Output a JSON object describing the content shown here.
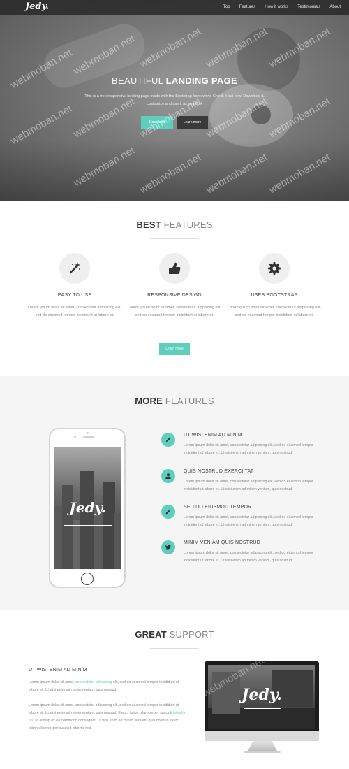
{
  "navbar": {
    "logo": "Jedy.",
    "items": [
      "Top",
      "Features",
      "How it works",
      "Testimonials",
      "About"
    ]
  },
  "hero": {
    "title_light": "BEAUTIFUL",
    "title_bold": "LANDING PAGE",
    "text": "This is a free responsive landing page made with the Bootstrap framework. Check it out now. Download it, customize and use it as you like!",
    "download_label": "Download",
    "learn_more_label": "Learn more"
  },
  "best_features": {
    "title_bold": "BEST",
    "title_light": "FEATURES",
    "items": [
      {
        "icon": "magic-wand-icon",
        "title": "EASY TO USE",
        "text": "Lorem ipsum dolor sit amet, consectetur adipiscing elit, sed do eiusmod tempor incididunt ut labore et."
      },
      {
        "icon": "thumbs-up-icon",
        "title": "RESPONSIVE DESIGN",
        "text": "Lorem ipsum dolor sit amet, consectetur adipiscing elit, sed do eiusmod tempor incididunt ut labore et."
      },
      {
        "icon": "gear-icon",
        "title": "USES BOOTSTRAP",
        "text": "Lorem ipsum dolor sit amet, consectetur adipiscing elit, sed do eiusmod tempor incididunt ut labore et."
      }
    ],
    "button_label": "Learn more"
  },
  "more_features": {
    "title_bold": "MORE",
    "title_light": "FEATURES",
    "phone_logo": "Jedy.",
    "items": [
      {
        "icon": "pencil-icon",
        "title": "UT WISI ENIM AD MINIM",
        "text": "Lorem ipsum dolor sit amet, consectetur adipiscing elit, sed do eiusmod tempor incididunt ut labore et. Ut wisi enim ad minim veniam, quis nostrud."
      },
      {
        "icon": "user-icon",
        "title": "QUIS NOSTRUD EXERCI TAT",
        "text": "Lorem ipsum dolor sit amet, consectetur adipiscing elit, sed do eiusmod tempor incididunt ut labore et. Ut wisi enim ad minim veniam, quis nostrud."
      },
      {
        "icon": "pen-icon",
        "title": "SED DO EIUSMOD TEMPOR",
        "text": "Lorem ipsum dolor sit amet, consectetur adipiscing elit, sed do eiusmod tempor incididunt ut labore et. Ut wisi enim ad minim veniam, quis nostrud."
      },
      {
        "icon": "twitter-icon",
        "title": "MINIM VENIAM QUIS NOSTRUD",
        "text": "Lorem ipsum dolor sit amet, consectetur adipiscing elit, sed do eiusmod tempor incididunt ut labore et. Ut wisi enim ad minim veniam, quis nostrud."
      }
    ]
  },
  "great_support": {
    "title_bold": "GREAT",
    "title_light": "SUPPORT",
    "subtitle": "UT WISI ENIM AD MINIM",
    "para1_a": "Lorem ipsum dolor sit amet,",
    "para1_link": "consectetur adipiscing",
    "para1_b": "elit, sed do eiusmod tempor incididunt ut labore et. Ut wisi enim ad minim veniam, quis nostrud.",
    "para2_a": "Lorem ipsum dolor sit amet, consectetur adipiscing elit, sed do eiusmod tempor incididunt ut labore et. Ut wisi enim ad minim veniam, quis nostrud. Exerci tation ullamcorper suscipit",
    "para2_link": "lobortis nisl",
    "para2_b": "ut aliquip ex ea commodo consequat. Ut wisi enim ad minim veniam, quis nostrud exerci tation ullamcorper suscipit lobortis nisl.",
    "monitor_logo": "Jedy."
  },
  "watermark": "webmoban.net",
  "colors": {
    "accent": "#5ecfbd",
    "nav_bg": "#2a2a2a",
    "section_gray": "#f5f5f5"
  }
}
